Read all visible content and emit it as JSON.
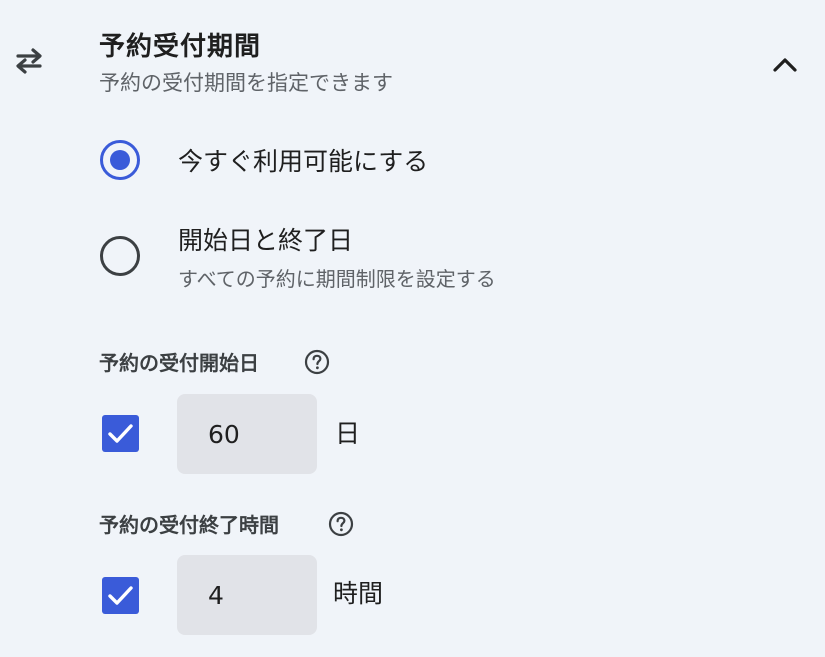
{
  "section": {
    "icon": "swap-horiz-icon",
    "title": "予約受付期間",
    "subtitle": "予約の受付期間を指定できます",
    "toggle_icon": "chevron-up-icon"
  },
  "radio_options": [
    {
      "label": "今すぐ利用可能にする",
      "description": "",
      "selected": true
    },
    {
      "label": "開始日と終了日",
      "description": "すべての予約に期間制限を設定する",
      "selected": false
    }
  ],
  "booking_start": {
    "label": "予約の受付開始日",
    "help_icon": "help-circle-icon",
    "enabled": true,
    "value": "60",
    "unit": "日"
  },
  "booking_end": {
    "label": "予約の受付終了時間",
    "help_icon": "help-circle-icon",
    "enabled": true,
    "value": "4",
    "unit": "時間"
  },
  "colors": {
    "accent": "#3a5bd9",
    "background": "#f0f4f9",
    "input_background": "#e1e3e8",
    "secondary_text": "#5f6368"
  }
}
